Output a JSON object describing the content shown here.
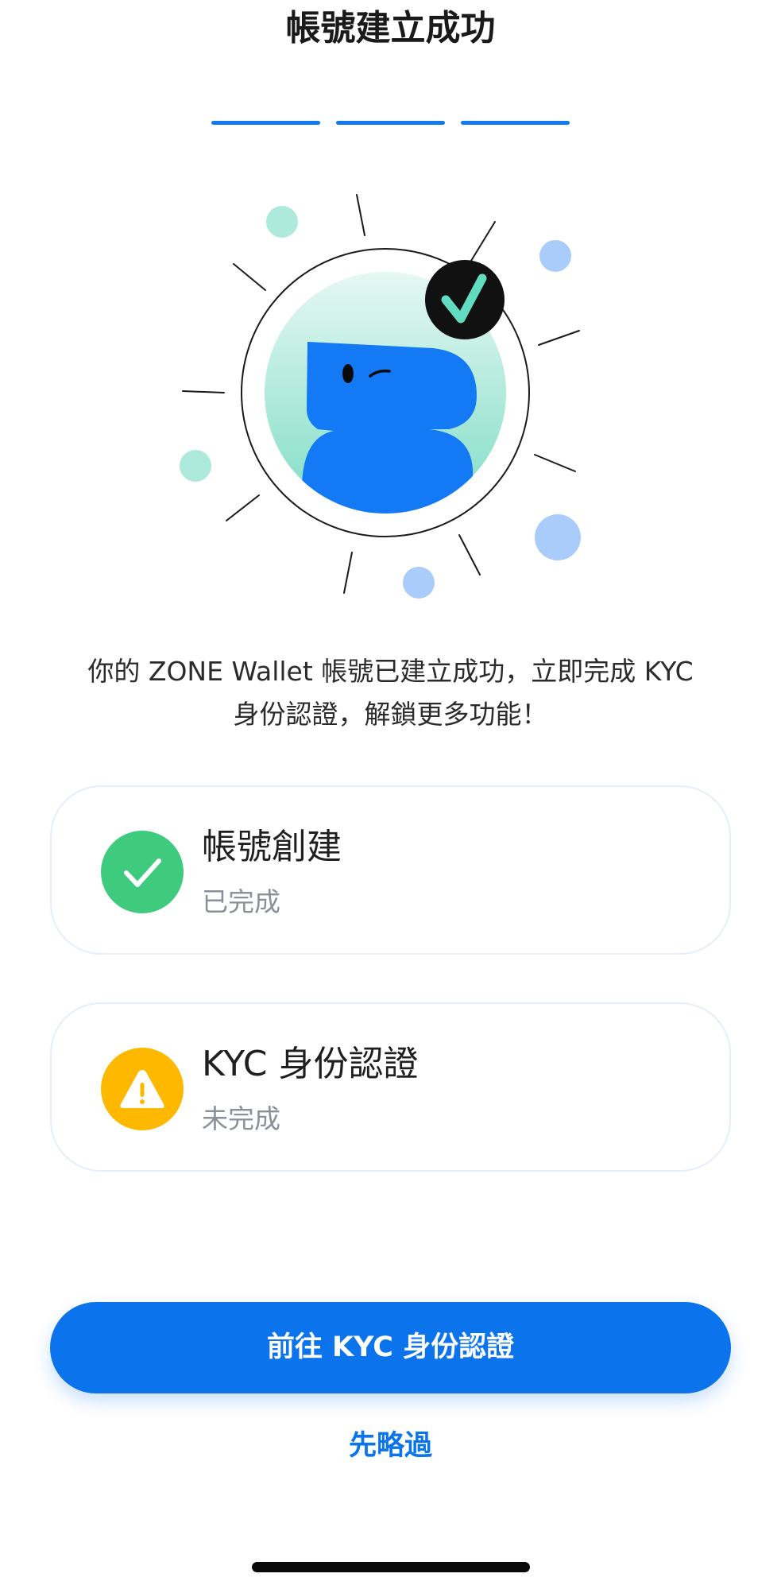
{
  "header": {
    "title": "帳號建立成功"
  },
  "progress": {
    "total_steps": 3,
    "completed_steps": 3
  },
  "illustration": {
    "icon": "mascot-success-illustration",
    "badge_icon": "checkmark-icon"
  },
  "intro": {
    "line1": "你的 ZONE Wallet 帳號已建立成功，立即完成 KYC",
    "line2": "身份認證，解鎖更多功能！"
  },
  "cards": [
    {
      "title": "帳號創建",
      "status": "已完成",
      "icon": "check-circle-icon",
      "color": "#3fcb7e"
    },
    {
      "title": "KYC 身份認證",
      "status": "未完成",
      "icon": "warning-icon",
      "color": "#ffb800"
    }
  ],
  "actions": {
    "primary_label": "前往 KYC 身份認證",
    "skip_label": "先略過"
  },
  "colors": {
    "accent": "#0b74ec",
    "success": "#3fcb7e",
    "warning": "#ffb800",
    "mascot": "#1479f5",
    "mint": "#9ee6d4"
  }
}
